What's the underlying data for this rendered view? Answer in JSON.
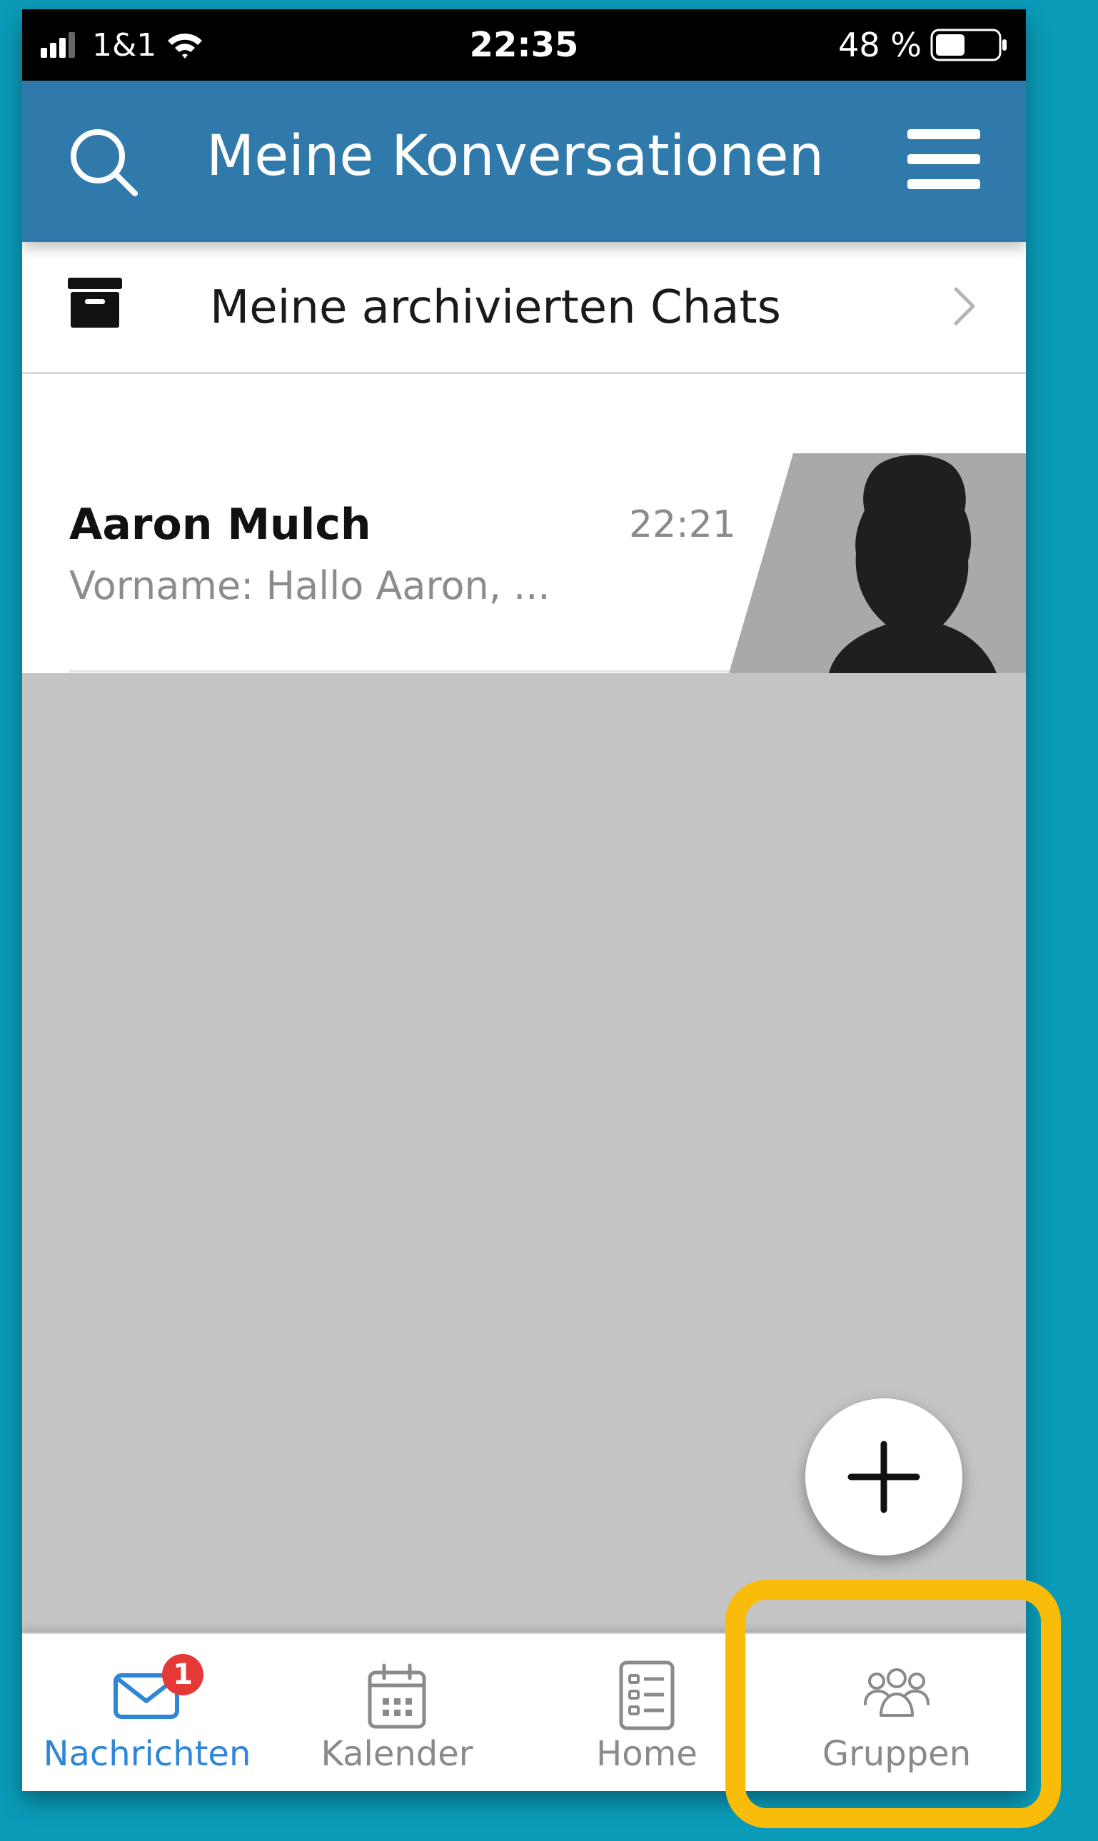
{
  "status_bar": {
    "carrier": "1&1",
    "time": "22:35",
    "battery": "48 %",
    "signal_icon": "signal-icon",
    "wifi_icon": "wifi-icon",
    "battery_icon": "battery-icon",
    "battery_level": 0.48
  },
  "header": {
    "title": "Meine Konversationen",
    "search_icon": "search-icon",
    "menu_icon": "hamburger-menu-icon",
    "background": "#2f7aaa"
  },
  "archived": {
    "label": "Meine archivierten Chats",
    "icon": "archive-box-icon",
    "chevron": "chevron-right-icon"
  },
  "conversations": [
    {
      "name": "Aaron Mulch",
      "time": "22:21",
      "preview": "Vorname: Hallo Aaron, ...",
      "avatar": "person-silhouette-avatar"
    }
  ],
  "fab": {
    "icon": "plus-icon"
  },
  "tabs": [
    {
      "label": "Nachrichten",
      "icon": "mail-icon",
      "active": true,
      "badge": "1"
    },
    {
      "label": "Kalender",
      "icon": "calendar-icon",
      "active": false
    },
    {
      "label": "Home",
      "icon": "list-document-icon",
      "active": false
    },
    {
      "label": "Gruppen",
      "icon": "group-people-icon",
      "active": false
    }
  ],
  "colors": {
    "page_background": "#0a9bb8",
    "accent_active_tab": "#2f86d6",
    "badge": "#e53935",
    "highlight": "#f9bc0b"
  }
}
